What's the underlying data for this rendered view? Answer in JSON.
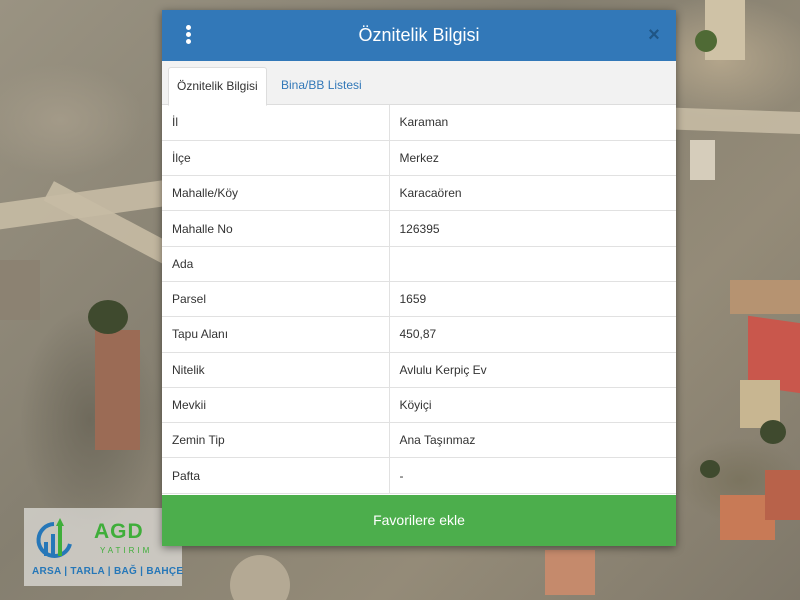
{
  "modal": {
    "title": "Öznitelik Bilgisi",
    "menu_icon": "kebab-menu-icon",
    "close_icon": "close-icon",
    "close_label": "×",
    "tabs": [
      {
        "label": "Öznitelik Bilgisi",
        "active": true
      },
      {
        "label": "Bina/BB Listesi",
        "active": false
      }
    ],
    "rows": [
      {
        "key": "İl",
        "value": "Karaman"
      },
      {
        "key": "İlçe",
        "value": "Merkez"
      },
      {
        "key": "Mahalle/Köy",
        "value": "Karacaören"
      },
      {
        "key": "Mahalle No",
        "value": "126395"
      },
      {
        "key": "Ada",
        "value": ""
      },
      {
        "key": "Parsel",
        "value": "1659"
      },
      {
        "key": "Tapu Alanı",
        "value": "450,87"
      },
      {
        "key": "Nitelik",
        "value": "Avlulu Kerpiç Ev"
      },
      {
        "key": "Mevkii",
        "value": "Köyiçi"
      },
      {
        "key": "Zemin Tip",
        "value": "Ana Taşınmaz"
      },
      {
        "key": "Pafta",
        "value": "-"
      }
    ],
    "favorite_button": "Favorilere ekle"
  },
  "colors": {
    "header": "#3278b8",
    "favorite_button": "#4cae4c",
    "logo_green": "#3fae3a",
    "logo_blue": "#2677b8"
  },
  "logo": {
    "name": "AGD",
    "sub": "YATIRIM",
    "tagline": "ARSA | TARLA | BAĞ | BAHÇE"
  }
}
